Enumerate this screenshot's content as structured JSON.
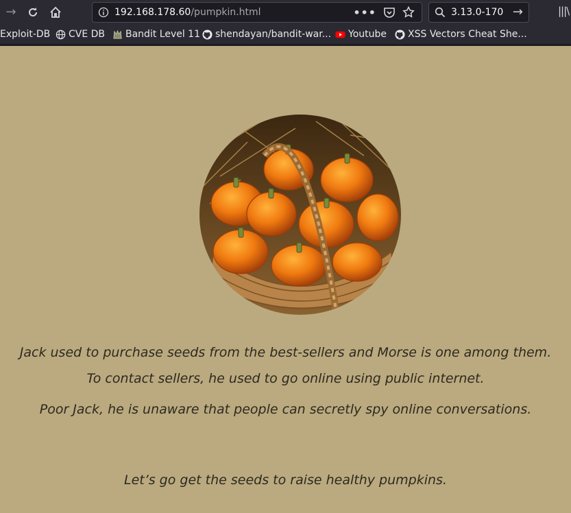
{
  "browser": {
    "url_host": "192.168.178.60",
    "url_path": "/pumpkin.html",
    "search_value": "3.13.0-170",
    "bookmarks": [
      {
        "label": "Exploit-DB",
        "icon": "exploit-db-icon"
      },
      {
        "label": "CVE DB",
        "icon": "globe-icon"
      },
      {
        "label": "Bandit Level 11",
        "icon": "bandit-icon"
      },
      {
        "label": "shendayan/bandit-war...",
        "icon": "github-icon"
      },
      {
        "label": "Youtube",
        "icon": "youtube-icon"
      },
      {
        "label": "XSS Vectors Cheat She...",
        "icon": "github-icon"
      }
    ]
  },
  "page": {
    "background": "#bbaa7f",
    "lines": [
      "Jack used to purchase seeds from the best-sellers and Morse is one among them.",
      "To contact sellers, he used to go online using public internet.",
      "Poor Jack, he is unaware that people can secretly spy online conversations.",
      "Let’s go get the seeds to raise healthy pumpkins."
    ]
  }
}
